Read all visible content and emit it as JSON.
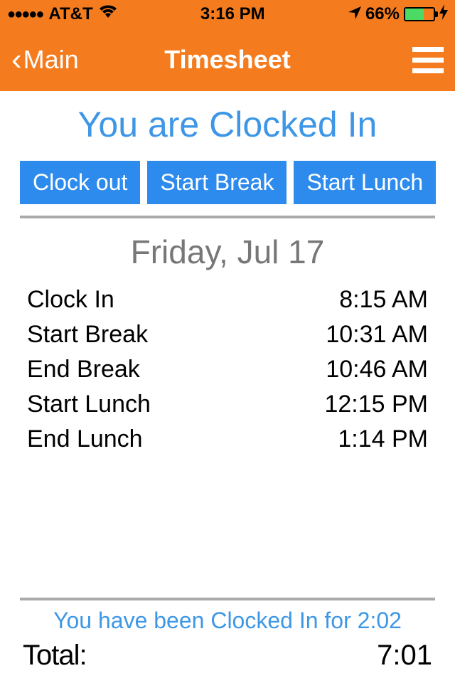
{
  "status_bar": {
    "carrier": "AT&T",
    "time": "3:16 PM",
    "battery_percent": "66%"
  },
  "nav": {
    "back_label": "Main",
    "title": "Timesheet"
  },
  "main": {
    "status_heading": "You are Clocked In",
    "actions": {
      "clock_out": "Clock out",
      "start_break": "Start Break",
      "start_lunch": "Start Lunch"
    },
    "date": "Friday, Jul 17",
    "events": [
      {
        "label": "Clock In",
        "time": "8:15 AM"
      },
      {
        "label": "Start Break",
        "time": "10:31 AM"
      },
      {
        "label": "End Break",
        "time": "10:46 AM"
      },
      {
        "label": "Start Lunch",
        "time": "12:15 PM"
      },
      {
        "label": "End Lunch",
        "time": "1:14 PM"
      }
    ]
  },
  "footer": {
    "duration_text": "You have been Clocked In for 2:02",
    "total_label": "Total:",
    "total_value": "7:01"
  }
}
